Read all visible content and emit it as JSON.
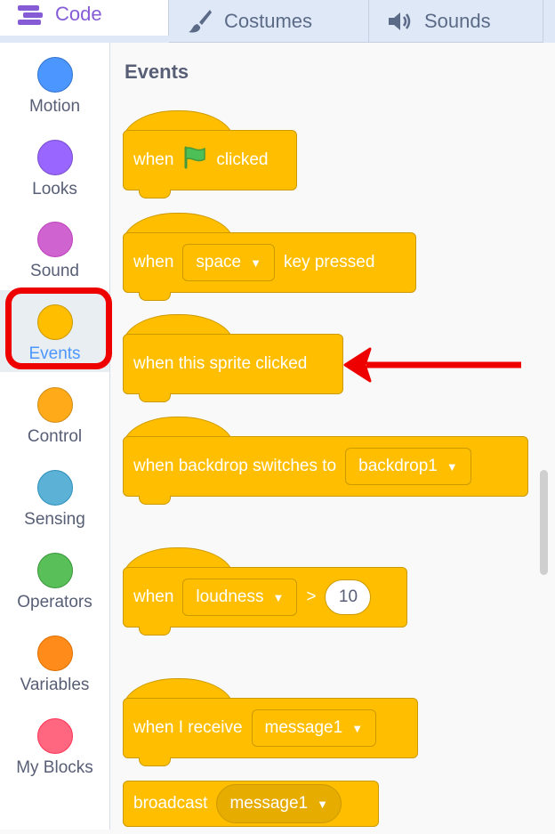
{
  "tabs": [
    {
      "label": "Code",
      "icon": "code-icon",
      "active": true
    },
    {
      "label": "Costumes",
      "icon": "brush-icon",
      "active": false
    },
    {
      "label": "Sounds",
      "icon": "speaker-icon",
      "active": false
    }
  ],
  "categories": [
    {
      "label": "Motion",
      "color": "#4c97ff",
      "border": "#3373cc"
    },
    {
      "label": "Looks",
      "color": "#9966ff",
      "border": "#774dcb"
    },
    {
      "label": "Sound",
      "color": "#cf63cf",
      "border": "#bd42bd"
    },
    {
      "label": "Events",
      "color": "#ffbf00",
      "border": "#cc9900",
      "selected": true
    },
    {
      "label": "Control",
      "color": "#ffab19",
      "border": "#cf8b17"
    },
    {
      "label": "Sensing",
      "color": "#5cb1d6",
      "border": "#2e8eb8"
    },
    {
      "label": "Operators",
      "color": "#59c059",
      "border": "#389438"
    },
    {
      "label": "Variables",
      "color": "#ff8c1a",
      "border": "#db6e00"
    },
    {
      "label": "My Blocks",
      "color": "#ff6680",
      "border": "#ff3355"
    }
  ],
  "palette": {
    "heading": "Events",
    "blocks": {
      "flag": {
        "when": "when",
        "icon": "green-flag-icon",
        "clicked": "clicked"
      },
      "key": {
        "when": "when",
        "dropdown": "space",
        "suffix": "key pressed"
      },
      "sprite": {
        "label": "when this sprite clicked"
      },
      "backdrop": {
        "label": "when backdrop switches to",
        "dropdown": "backdrop1"
      },
      "loudness": {
        "when": "when",
        "dropdown": "loudness",
        "operator": ">",
        "value": "10"
      },
      "receive": {
        "label": "when I receive",
        "dropdown": "message1"
      },
      "broadcast": {
        "label": "broadcast",
        "dropdown": "message1"
      }
    }
  },
  "colors": {
    "events_block": "#ffbf00",
    "block_border": "#cc9900",
    "annotation": "#ee0000"
  }
}
